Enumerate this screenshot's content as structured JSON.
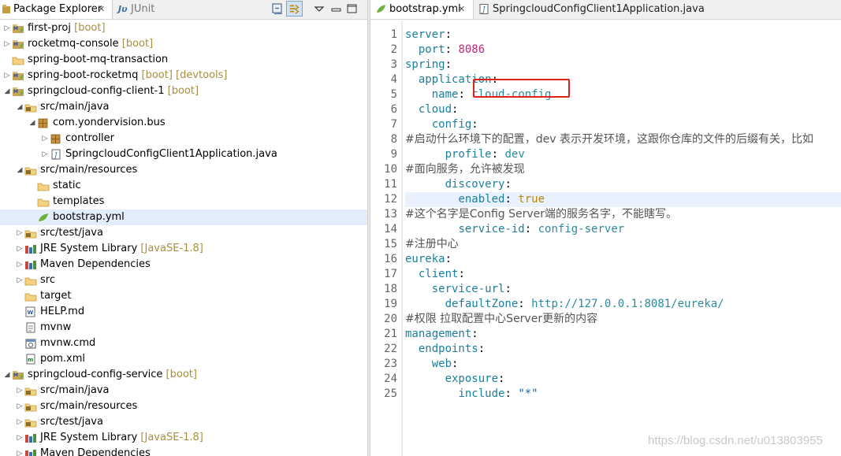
{
  "left_panel": {
    "tabs": [
      {
        "label": "Package Explorer",
        "close": "✕"
      },
      {
        "label": "JUnit",
        "icon": "Jυ"
      }
    ],
    "tree": [
      {
        "label": "first-proj",
        "decoration": "[boot]",
        "icon": "project-icon"
      },
      {
        "label": "rocketmq-console",
        "decoration": "[boot]",
        "icon": "project-icon"
      },
      {
        "label": "spring-boot-mq-transaction",
        "decoration": "",
        "icon": "folder-icon"
      },
      {
        "label": "spring-boot-rocketmq",
        "decoration": "[boot] [devtools]",
        "icon": "project-icon"
      },
      {
        "label": "springcloud-config-client-1",
        "decoration": "[boot]",
        "icon": "project-icon"
      },
      {
        "label": "src/main/java",
        "decoration": "",
        "icon": "source-folder-icon"
      },
      {
        "label": "com.yondervision.bus",
        "decoration": "",
        "icon": "package-icon"
      },
      {
        "label": "controller",
        "decoration": "",
        "icon": "package-icon"
      },
      {
        "label": "SpringcloudConfigClient1Application.java",
        "decoration": "",
        "icon": "java-file-icon"
      },
      {
        "label": "src/main/resources",
        "decoration": "",
        "icon": "source-folder-icon"
      },
      {
        "label": "static",
        "decoration": "",
        "icon": "folder-icon"
      },
      {
        "label": "templates",
        "decoration": "",
        "icon": "folder-icon"
      },
      {
        "label": "bootstrap.yml",
        "decoration": "",
        "icon": "yml-file-icon"
      },
      {
        "label": "src/test/java",
        "decoration": "",
        "icon": "source-folder-icon"
      },
      {
        "label": "JRE System Library",
        "decoration": "[JavaSE-1.8]",
        "icon": "library-icon"
      },
      {
        "label": "Maven Dependencies",
        "decoration": "",
        "icon": "library-icon"
      },
      {
        "label": "src",
        "decoration": "",
        "icon": "folder-icon"
      },
      {
        "label": "target",
        "decoration": "",
        "icon": "folder-icon"
      },
      {
        "label": "HELP.md",
        "decoration": "",
        "icon": "markdown-file-icon"
      },
      {
        "label": "mvnw",
        "decoration": "",
        "icon": "text-file-icon"
      },
      {
        "label": "mvnw.cmd",
        "decoration": "",
        "icon": "cmd-file-icon"
      },
      {
        "label": "pom.xml",
        "decoration": "",
        "icon": "xml-file-icon"
      },
      {
        "label": "springcloud-config-service",
        "decoration": "[boot]",
        "icon": "project-icon"
      },
      {
        "label": "src/main/java",
        "decoration": "",
        "icon": "source-folder-icon"
      },
      {
        "label": "src/main/resources",
        "decoration": "",
        "icon": "source-folder-icon"
      },
      {
        "label": "src/test/java",
        "decoration": "",
        "icon": "source-folder-icon"
      },
      {
        "label": "JRE System Library",
        "decoration": "[JavaSE-1.8]",
        "icon": "library-icon"
      },
      {
        "label": "Maven Dependencies",
        "decoration": "",
        "icon": "library-icon"
      }
    ]
  },
  "editor": {
    "tabs": [
      {
        "label": "bootstrap.yml",
        "close": "✕"
      },
      {
        "label": "SpringcloudConfigClient1Application.java"
      }
    ],
    "lines": [
      "server:",
      "  port: 8086",
      "spring:",
      "  application:",
      "    name: cloud-config",
      "  cloud:",
      "    config:",
      "#启动什么环境下的配置，dev 表示开发环境，这跟你仓库的文件的后缀有关，比如",
      "      profile: dev",
      "#面向服务，允许被发现",
      "      discovery:",
      "        enabled: true",
      "#这个名字是Config Server端的服务名字，不能瞎写。",
      "        service-id: config-server",
      "#注册中心",
      "eureka:",
      "  client:",
      "    service-url:",
      "      defaultZone: http://127.0.0.1:8081/eureka/",
      "#权限 拉取配置中心Server更新的内容",
      "management:",
      "  endpoints:",
      "    web:",
      "      exposure:",
      "        include: \"*\""
    ],
    "highlighted_line": 12,
    "boxed_value": "cloud-config"
  },
  "watermark": "https://blog.csdn.net/u013803955"
}
